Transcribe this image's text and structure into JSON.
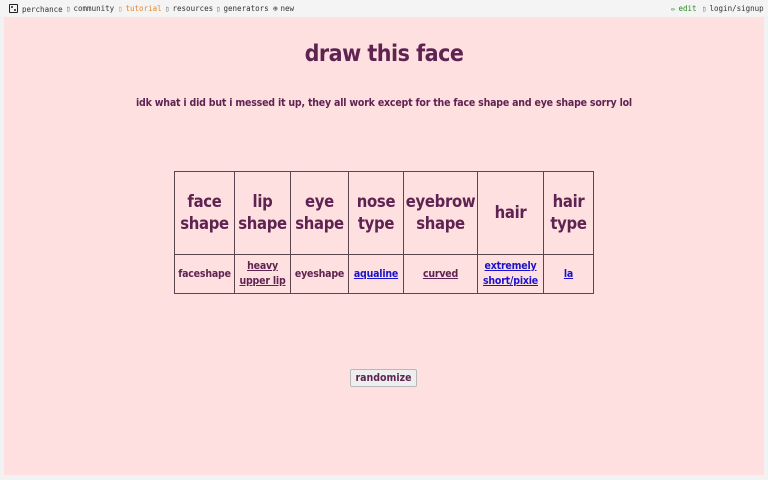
{
  "nav": {
    "home": "perchance",
    "community": "community",
    "tutorial": "tutorial",
    "resources": "resources",
    "generators": "generators",
    "new": "new",
    "edit": "edit",
    "login": "login/signup"
  },
  "page": {
    "title": "draw this face",
    "subtitle": "idk what i did but i messed it up, they all work except for the face shape and eye shape sorry lol"
  },
  "table": {
    "headers": [
      "face shape",
      "lip shape",
      "eye shape",
      "nose type",
      "eyebrow shape",
      "hair",
      "hair type"
    ],
    "values": [
      "faceshape",
      "heavy upper lip",
      "eyeshape",
      "aqualine",
      "curved",
      "extremely short/pixie",
      "la"
    ]
  },
  "button": {
    "randomize": "randomize"
  },
  "colors": {
    "page_bg": "#ffe0e0",
    "text": "#5e2351",
    "link": "#1a12cc",
    "tutorial_link": "#e8862a",
    "edit_link": "#2a8a2a"
  }
}
